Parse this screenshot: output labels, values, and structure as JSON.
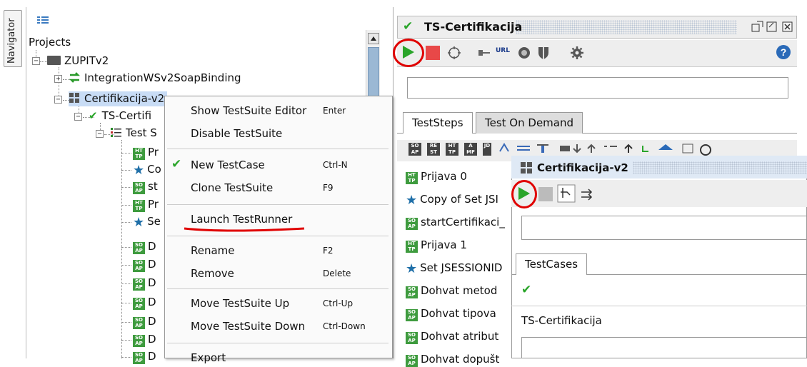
{
  "navigator": {
    "label": "Navigator"
  },
  "tree": {
    "root": "Projects",
    "project": "ZUPITv2",
    "items": [
      {
        "label": "IntegrationWSv2SoapBinding"
      },
      {
        "label": "Certifikacija-v2"
      },
      {
        "label": "TS-Certifi"
      },
      {
        "label": "Test S"
      }
    ],
    "children": [
      {
        "icon": "ht",
        "label": "Pr"
      },
      {
        "icon": "star",
        "label": "Co"
      },
      {
        "icon": "soap",
        "label": "st"
      },
      {
        "icon": "ht",
        "label": "Pr"
      },
      {
        "icon": "star",
        "label": "Se"
      },
      {
        "icon": "soap",
        "label": "D"
      },
      {
        "icon": "soap",
        "label": "D"
      },
      {
        "icon": "soap",
        "label": "D"
      },
      {
        "icon": "soap",
        "label": "D"
      },
      {
        "icon": "soap",
        "label": "D"
      },
      {
        "icon": "soap",
        "label": "D"
      },
      {
        "icon": "soap",
        "label": "D"
      }
    ]
  },
  "context_menu": {
    "items": [
      {
        "label": "Show TestSuite Editor",
        "shortcut": "Enter"
      },
      {
        "label": "Disable TestSuite",
        "shortcut": ""
      },
      {
        "label": "New TestCase",
        "shortcut": "Ctrl-N",
        "checked": true
      },
      {
        "label": "Clone TestSuite",
        "shortcut": "F9"
      },
      {
        "label": "Launch TestRunner",
        "shortcut": ""
      },
      {
        "label": "Rename",
        "shortcut": "F2"
      },
      {
        "label": "Remove",
        "shortcut": "Delete"
      },
      {
        "label": "Move TestSuite Up",
        "shortcut": "Ctrl-Up"
      },
      {
        "label": "Move TestSuite Down",
        "shortcut": "Ctrl-Down"
      },
      {
        "label": "Export",
        "shortcut": ""
      }
    ]
  },
  "ts_panel": {
    "title": "TS-Certifikacija",
    "url_label": "URL",
    "tabs": [
      "TestSteps",
      "Test On Demand"
    ],
    "steps": [
      {
        "icon": "ht",
        "label": "Prijava 0"
      },
      {
        "icon": "star",
        "label": "Copy of Set JSI"
      },
      {
        "icon": "soap",
        "label": "startCertifikaci_"
      },
      {
        "icon": "ht",
        "label": "Prijava 1"
      },
      {
        "icon": "star",
        "label": "Set JSESSIONID"
      },
      {
        "icon": "soap",
        "label": "Dohvat metod"
      },
      {
        "icon": "soap",
        "label": "Dohvat tipova"
      },
      {
        "icon": "soap",
        "label": "Dohvat atribut"
      },
      {
        "icon": "soap",
        "label": "Dohvat dopušt"
      }
    ]
  },
  "cv2_panel": {
    "title": "Certifikacija-v2",
    "tab": "TestCases",
    "testcase": "TS-Certifikacija"
  },
  "colors": {
    "run_green": "#2aa52a",
    "stop_red": "#e84848",
    "annotation_red": "#e00000",
    "selection_blue": "#c8dcf5"
  }
}
